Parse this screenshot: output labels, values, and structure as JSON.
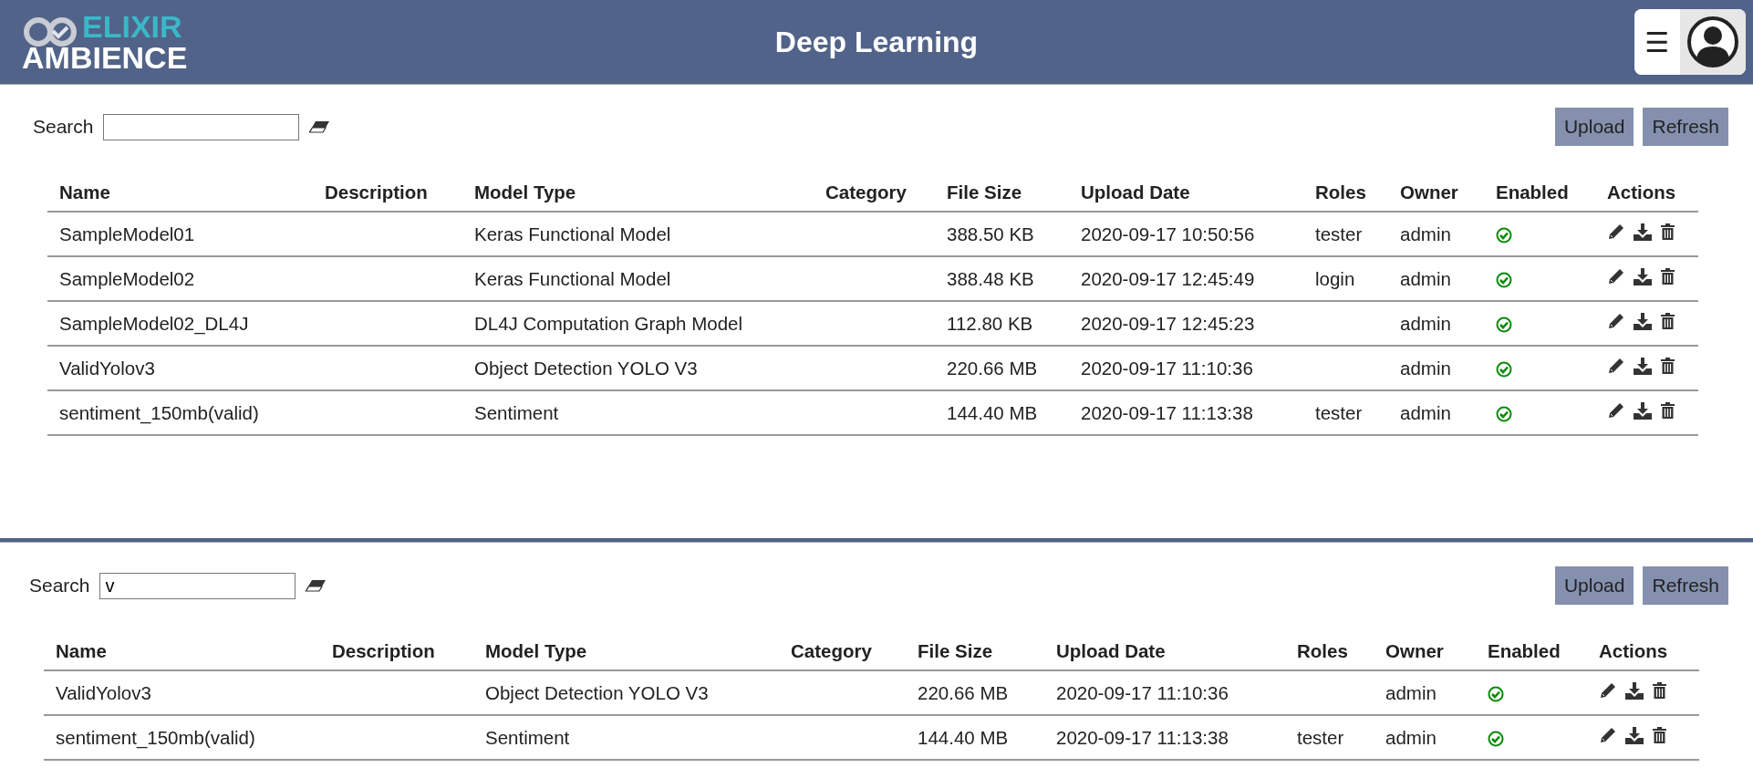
{
  "header": {
    "logo_top": "ELIXIR",
    "logo_bottom": "AMBIENCE",
    "title": "Deep Learning",
    "menu_glyph": "☰"
  },
  "panels": [
    {
      "search": {
        "label": "Search"
      },
      "buttons": [
        "Upload",
        "Refresh"
      ],
      "columns": [
        "Name",
        "Description",
        "Model Type",
        "Category",
        "File Size",
        "Upload Date",
        "Roles",
        "Owner",
        "Enabled",
        "Actions"
      ],
      "rows": [
        {
          "name": "SampleModel01",
          "model_type": "Keras Functional Model",
          "file_size": "388.50 KB",
          "upload_date": "2020-09-17 10:50:56",
          "roles": "tester",
          "owner": "admin",
          "enabled": true
        },
        {
          "name": "SampleModel02",
          "model_type": "Keras Functional Model",
          "file_size": "388.48 KB",
          "upload_date": "2020-09-17 12:45:49",
          "roles": "login",
          "owner": "admin",
          "enabled": true
        },
        {
          "name": "SampleModel02_DL4J",
          "model_type": "DL4J Computation Graph Model",
          "file_size": "112.80 KB",
          "upload_date": "2020-09-17 12:45:23",
          "owner": "admin",
          "enabled": true
        },
        {
          "name": "ValidYolov3",
          "model_type": "Object Detection YOLO V3",
          "file_size": "220.66 MB",
          "upload_date": "2020-09-17 11:10:36",
          "owner": "admin",
          "enabled": true
        },
        {
          "name": "sentiment_150mb(valid)",
          "model_type": "Sentiment",
          "file_size": "144.40 MB",
          "upload_date": "2020-09-17 11:13:38",
          "roles": "tester",
          "owner": "admin",
          "enabled": true
        }
      ]
    },
    {
      "search": {
        "label": "Search",
        "value": "v"
      },
      "buttons": [
        "Upload",
        "Refresh"
      ],
      "columns": [
        "Name",
        "Description",
        "Model Type",
        "Category",
        "File Size",
        "Upload Date",
        "Roles",
        "Owner",
        "Enabled",
        "Actions"
      ],
      "rows": [
        {
          "name": "ValidYolov3",
          "model_type": "Object Detection YOLO V3",
          "file_size": "220.66 MB",
          "upload_date": "2020-09-17 11:10:36",
          "owner": "admin",
          "enabled": true
        },
        {
          "name": "sentiment_150mb(valid)",
          "model_type": "Sentiment",
          "file_size": "144.40 MB",
          "upload_date": "2020-09-17 11:13:38",
          "roles": "tester",
          "owner": "admin",
          "enabled": true
        }
      ]
    }
  ]
}
